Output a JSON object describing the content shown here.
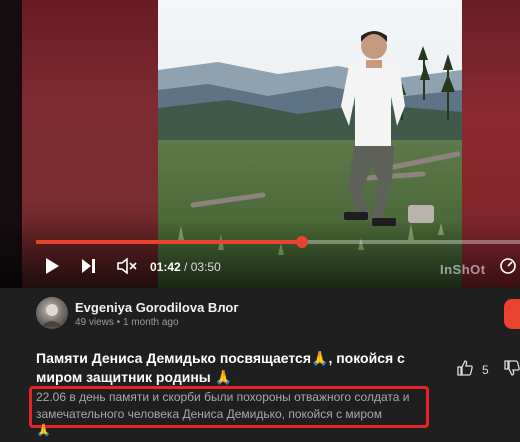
{
  "player": {
    "progress_fraction": 0.5488,
    "current_time": "01:42",
    "duration": "03:50",
    "watermark": "InShOt",
    "accent_color": "#e8432e"
  },
  "channel": {
    "name": "Evgeniya Gorodilova Влог",
    "meta": "49 views • 1 month ago"
  },
  "video": {
    "title": "Памяти Дениса Демидько посвящается🙏, покойся с миром защитник родины 🙏",
    "likes": "5",
    "description": "22.06 в день памяти и скорби были похороны отважного солдата и замечательного человека Дениса Демидько, покойся с миром",
    "description_extra": "🙏"
  },
  "icons": [
    "play-icon",
    "next-icon",
    "mute-icon",
    "speed-icon",
    "like-icon",
    "dislike-icon"
  ],
  "highlight_color": "#e4242b"
}
